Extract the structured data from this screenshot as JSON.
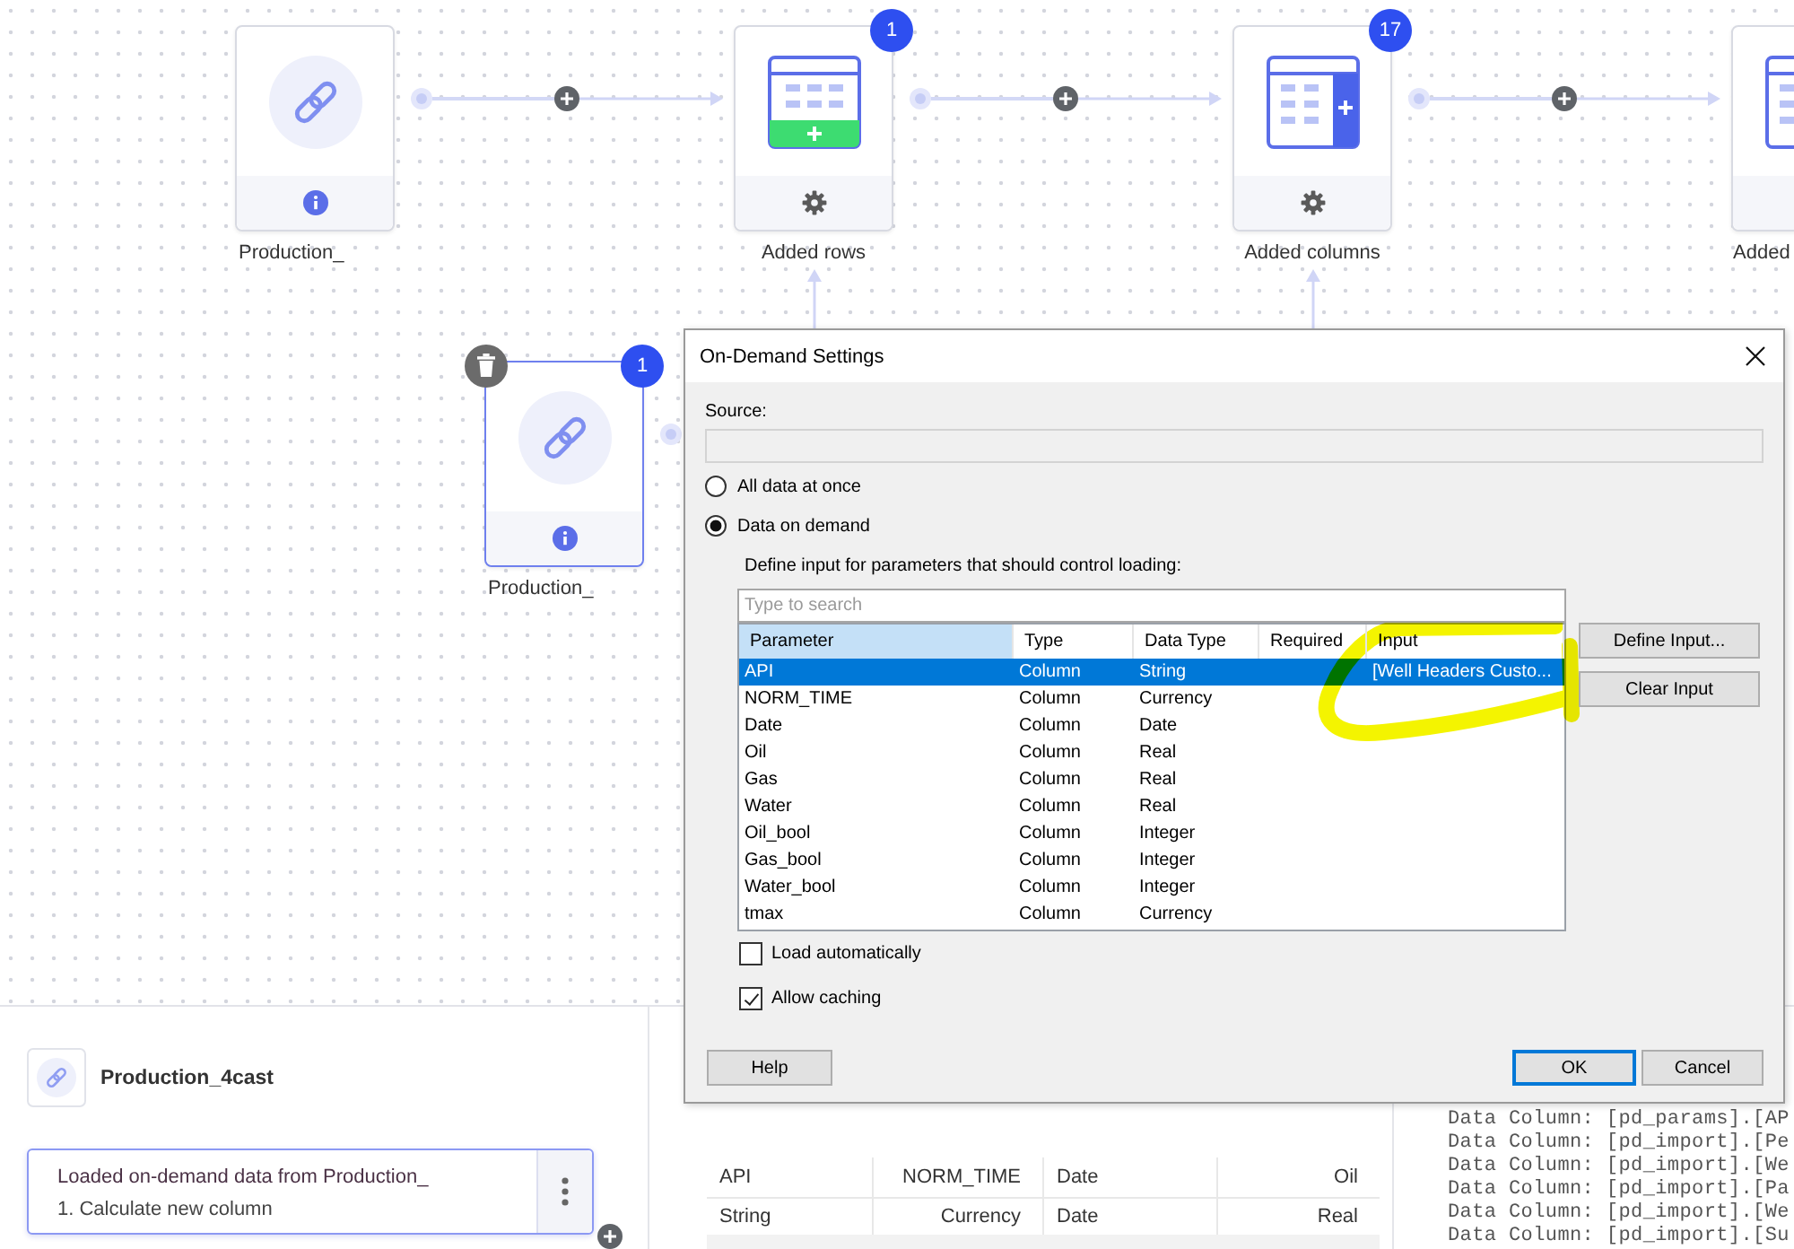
{
  "canvas": {
    "flow": {
      "nodes": [
        {
          "kind": "source",
          "label": "Production_",
          "selected": false,
          "branch_input": false
        },
        {
          "kind": "add_rows",
          "label": "Added rows",
          "badge": "1",
          "selected": false,
          "branch_input": true
        },
        {
          "kind": "add_columns",
          "label": "Added columns",
          "badge": "17",
          "selected": false,
          "branch_input": true
        },
        {
          "kind": "add_columns",
          "label": "Added",
          "selected": false,
          "branch_input": false
        }
      ]
    },
    "branch": {
      "nodes": [
        {
          "kind": "source",
          "label": "Production_",
          "badge": "1",
          "selected": true,
          "branch_input": false
        }
      ]
    }
  },
  "dialog": {
    "title": "On-Demand Settings",
    "source_label": "Source:",
    "load_modes": [
      {
        "label": "All data at once",
        "selected": false
      },
      {
        "label": "Data on demand",
        "selected": true
      }
    ],
    "parameters_hint": "Define input for parameters that should control loading:",
    "search": {
      "placeholder": "Type to search"
    },
    "columns": [
      {
        "label": "Parameter",
        "highlighted": true
      },
      {
        "label": "Type",
        "highlighted": false
      },
      {
        "label": "Data Type",
        "highlighted": false
      },
      {
        "label": "Required",
        "highlighted": false
      },
      {
        "label": "Input",
        "highlighted": false
      }
    ],
    "rows": [
      {
        "parameter": "API",
        "type": "Column",
        "data_type": "String",
        "input": "[Well Headers Custo...",
        "selected": true
      },
      {
        "parameter": "NORM_TIME",
        "type": "Column",
        "data_type": "Currency",
        "selected": false
      },
      {
        "parameter": "Date",
        "type": "Column",
        "data_type": "Date",
        "selected": false
      },
      {
        "parameter": "Oil",
        "type": "Column",
        "data_type": "Real",
        "selected": false
      },
      {
        "parameter": "Gas",
        "type": "Column",
        "data_type": "Real",
        "selected": false
      },
      {
        "parameter": "Water",
        "type": "Column",
        "data_type": "Real",
        "selected": false
      },
      {
        "parameter": "Oil_bool",
        "type": "Column",
        "data_type": "Integer",
        "selected": false
      },
      {
        "parameter": "Gas_bool",
        "type": "Column",
        "data_type": "Integer",
        "selected": false
      },
      {
        "parameter": "Water_bool",
        "type": "Column",
        "data_type": "Integer",
        "selected": false
      },
      {
        "parameter": "tmax",
        "type": "Column",
        "data_type": "Currency",
        "selected": false
      }
    ],
    "side_buttons": [
      "Define Input...",
      "Clear Input"
    ],
    "options": [
      {
        "label": "Load automatically",
        "checked": false
      },
      {
        "label": "Allow caching",
        "checked": true
      }
    ],
    "buttons": [
      {
        "label": "Help",
        "default": false
      },
      {
        "label": "OK",
        "default": true
      },
      {
        "label": "Cancel",
        "default": false
      }
    ]
  },
  "details": {
    "source_name": "Production_4cast",
    "step": {
      "title": "Loaded on-demand data from Production_",
      "items": [
        "1. Calculate new column"
      ]
    }
  },
  "preview_table": {
    "columns": [
      {
        "name": "API",
        "type": "String",
        "numeric": false
      },
      {
        "name": "NORM_TIME",
        "type": "Currency",
        "numeric": true
      },
      {
        "name": "Date",
        "type": "Date",
        "numeric": false
      },
      {
        "name": "Oil",
        "type": "Real",
        "numeric": true
      }
    ]
  },
  "log": {
    "lines": [
      "Data Column: [pd_params].[AP",
      "Data Column: [pd_import].[Pe",
      "Data Column: [pd_import].[We",
      "Data Column: [pd_import].[Pa",
      "Data Column: [pd_import].[We",
      "Data Column: [pd_import].[Su"
    ]
  }
}
